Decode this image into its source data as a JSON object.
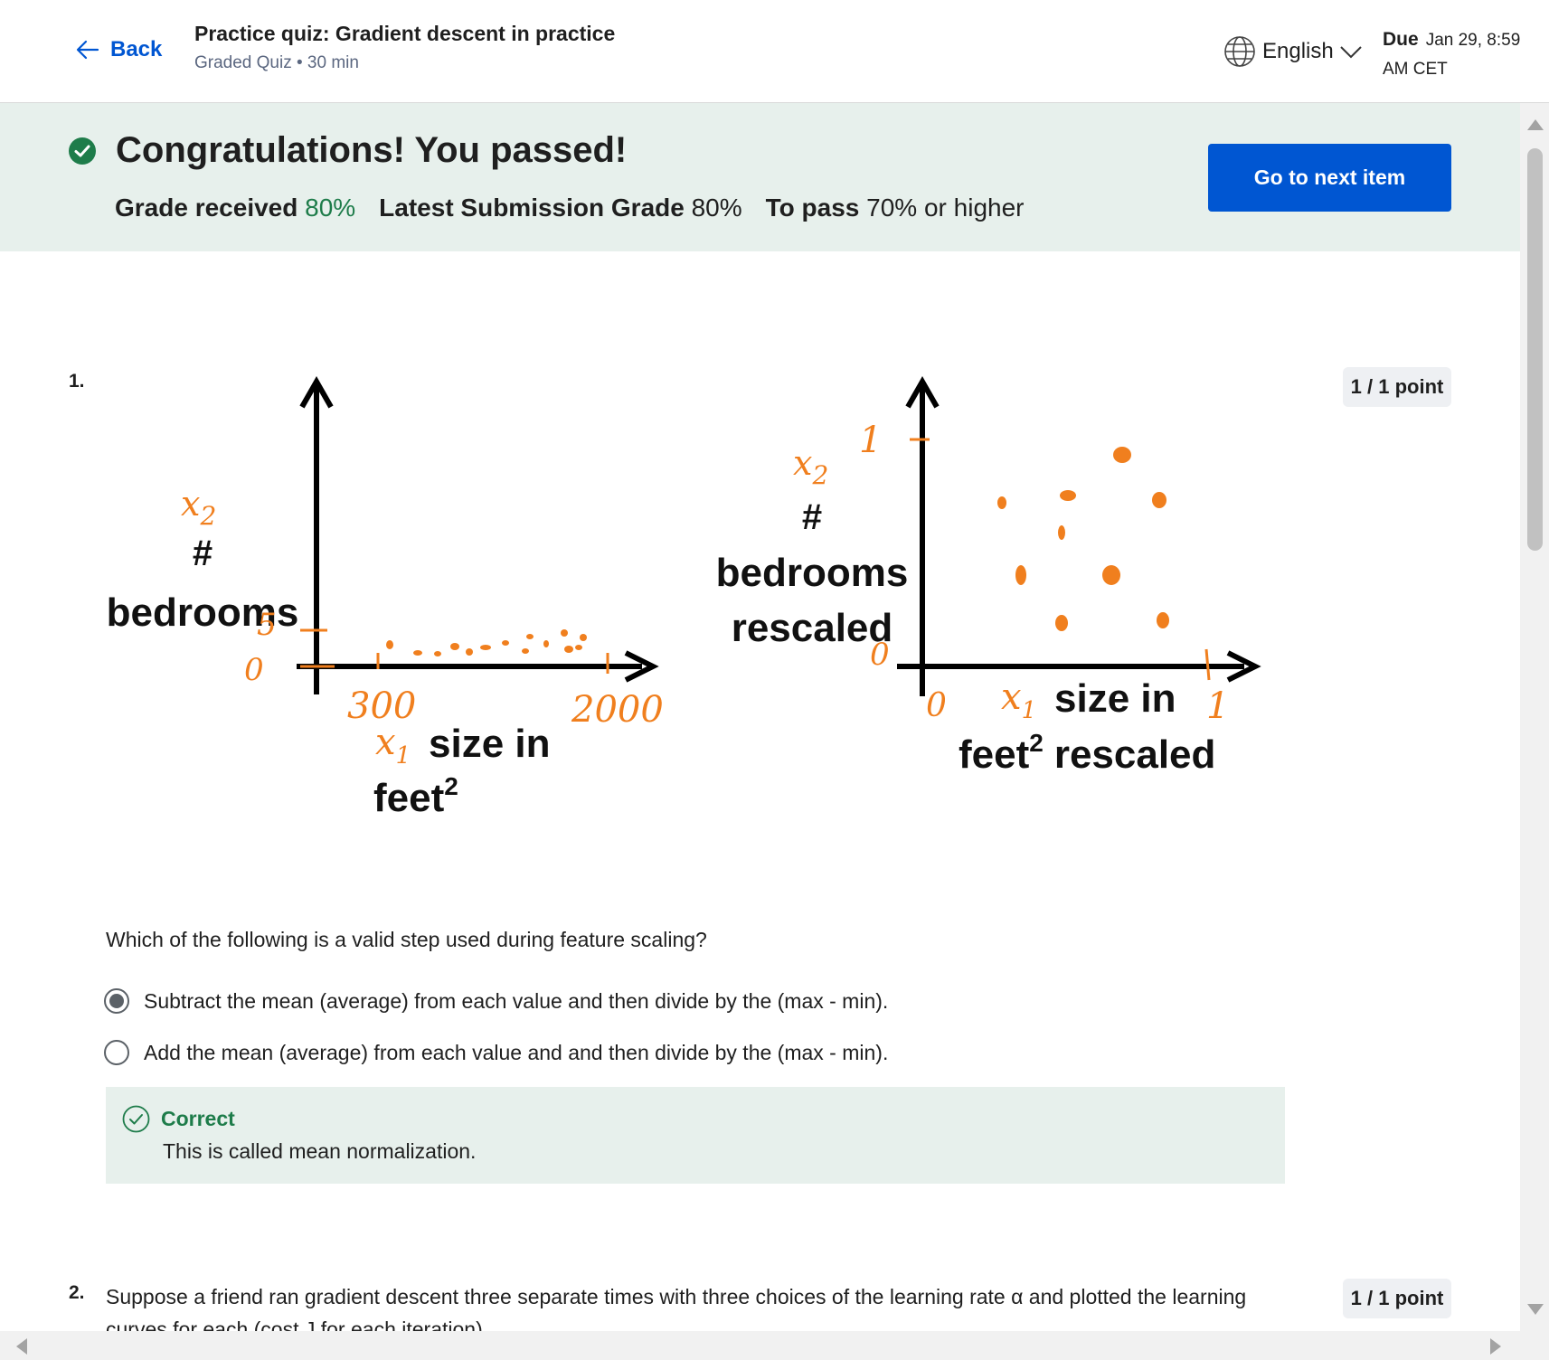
{
  "header": {
    "back_label": "Back",
    "title": "Practice quiz: Gradient descent in practice",
    "subtitle": "Graded Quiz • 30 min",
    "language": "English",
    "due_label": "Due",
    "due_date_line1": "Jan 29, 8:59",
    "due_date_line2": "AM CET"
  },
  "banner": {
    "title": "Congratulations! You passed!",
    "grade_received_label": "Grade received",
    "grade_received_value": "80%",
    "latest_label": "Latest Submission Grade",
    "latest_value": "80%",
    "to_pass_label": "To pass",
    "to_pass_value": "70% or higher",
    "next_button": "Go to next item"
  },
  "questions": [
    {
      "number": "1.",
      "points": "1 / 1 point",
      "figure": {
        "left": {
          "ylabel_var": "x",
          "ylabel_sub": "2",
          "ylabel_hash": "#",
          "ylabel_text": "bedrooms",
          "y_tick_top": "5",
          "y_tick_bottom": "0",
          "x_tick_left": "300",
          "x_tick_right": "2000",
          "xlabel_var": "x",
          "xlabel_sub": "1",
          "xlabel_text": "size in",
          "xlabel_text2": "feet",
          "xlabel_sup": "2"
        },
        "right": {
          "ylabel_var": "x",
          "ylabel_sub": "2",
          "ylabel_hash": "#",
          "ylabel_text": "bedrooms",
          "ylabel_text2": "rescaled",
          "y_tick_top": "1",
          "y_tick_bottom": "0",
          "x_tick_left": "0",
          "x_tick_right": "1",
          "xlabel_var": "x",
          "xlabel_sub": "1",
          "xlabel_text": "size in",
          "xlabel_text2": "feet",
          "xlabel_sup": "2",
          "xlabel_text3": "rescaled"
        }
      },
      "prompt": "Which of the following is a valid step used during feature scaling?",
      "options": [
        {
          "label": "Subtract the mean (average) from each value and then divide by the (max - min).",
          "selected": true
        },
        {
          "label": "Add the mean (average) from each value and and then divide by the (max - min).",
          "selected": false
        }
      ],
      "feedback": {
        "status": "Correct",
        "text": "This is called mean normalization."
      }
    },
    {
      "number": "2.",
      "points": "1 / 1 point",
      "prompt": "Suppose a friend ran gradient descent three separate times with three choices of the learning rate α and plotted the learning curves for each (cost J for each iteration)."
    }
  ],
  "colors": {
    "brand_blue": "#0056d2",
    "success_green": "#1e7c4a",
    "banner_bg": "#e7f0ec",
    "sketch_orange": "#f07f1e"
  }
}
